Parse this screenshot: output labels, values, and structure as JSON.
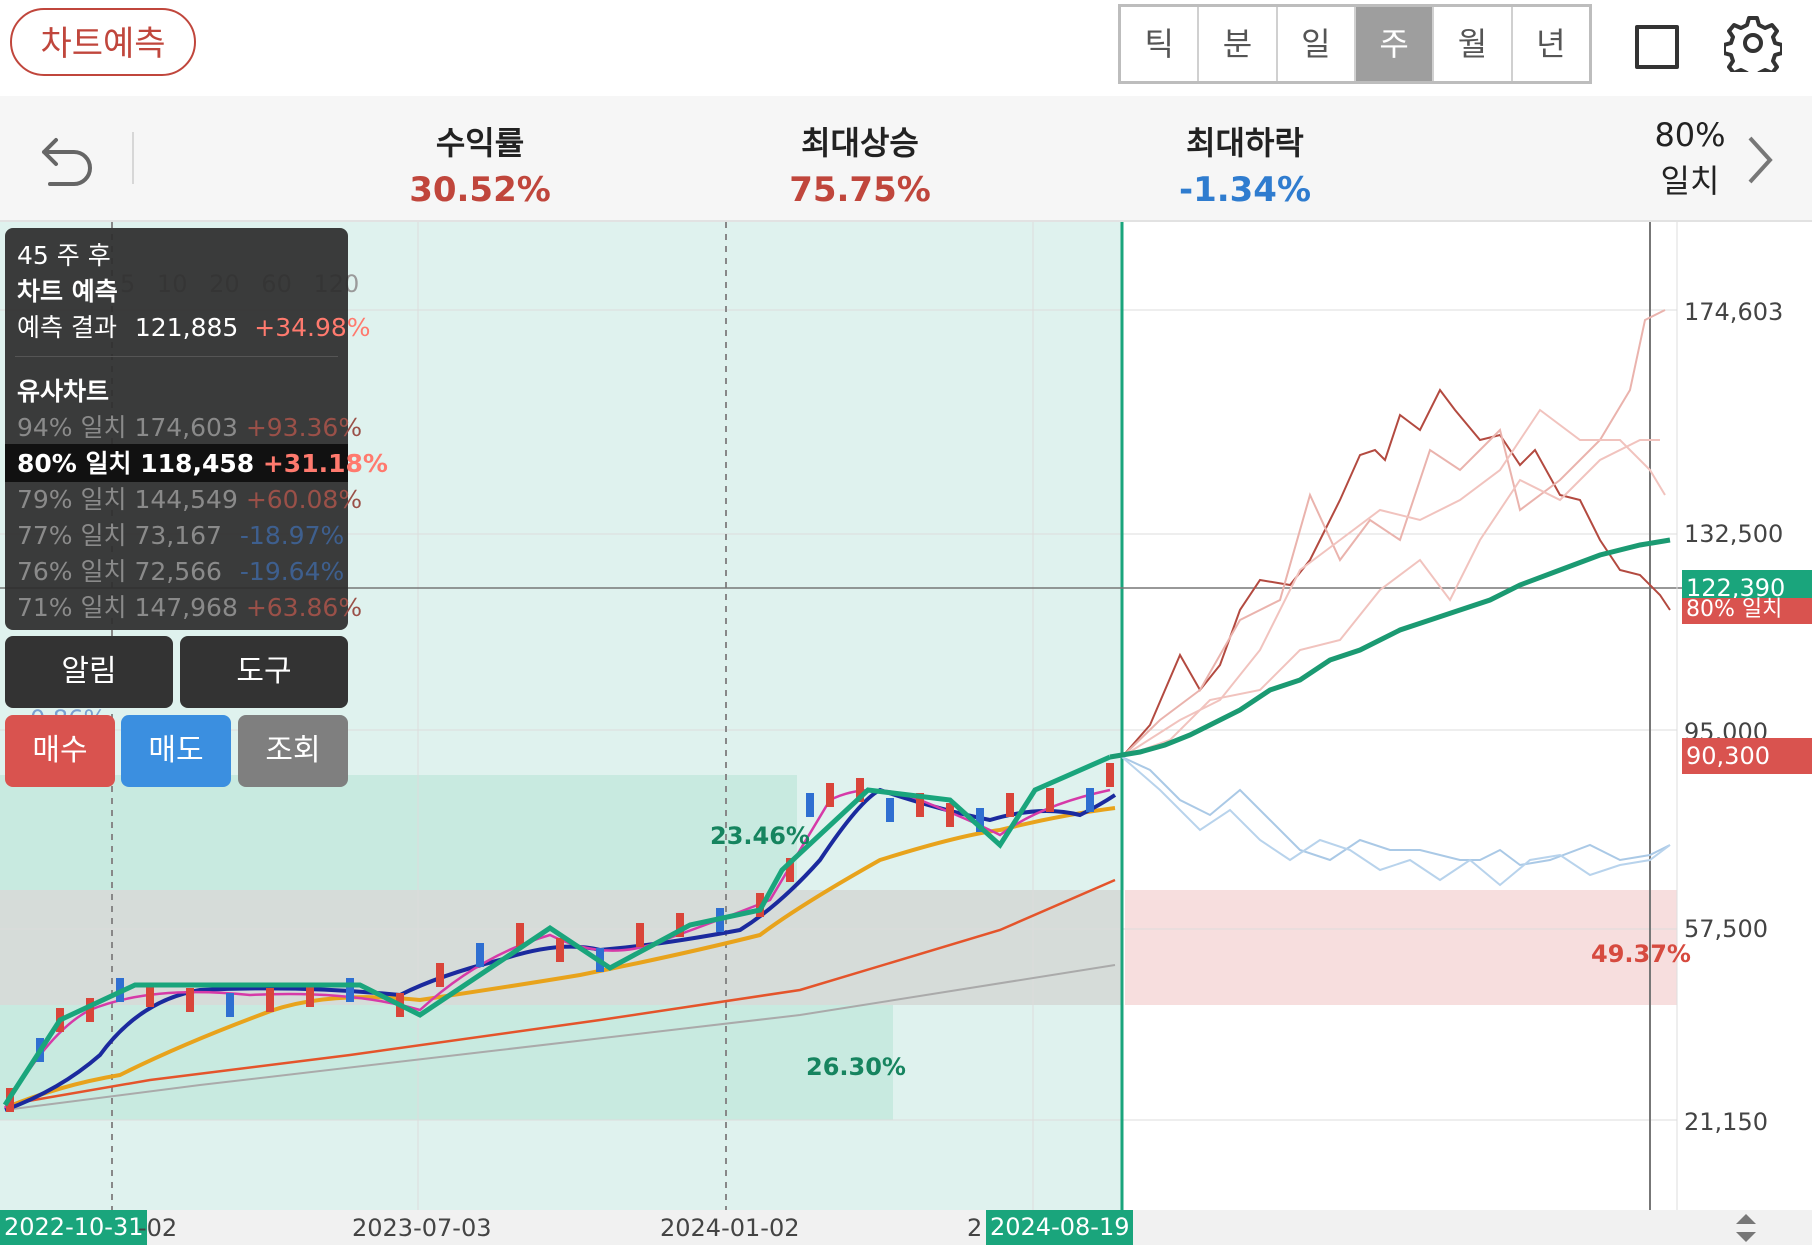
{
  "header": {
    "predict_button": "차트예측",
    "period_tabs": [
      "틱",
      "분",
      "일",
      "주",
      "월",
      "년"
    ],
    "active_tab": "주",
    "icons": [
      "square-icon",
      "gear-icon"
    ]
  },
  "summary": {
    "return_label": "수익률",
    "return_value": "30.52%",
    "max_rise_label": "최대상승",
    "max_rise_value": "75.75%",
    "max_drop_label": "최대하락",
    "max_drop_value": "-1.34%",
    "match_pct": "80%",
    "match_label": "일치",
    "icons": [
      "undo-icon",
      "chevron-right-icon"
    ]
  },
  "panel": {
    "weeks_after": "45 주 후",
    "prediction_title": "차트 예측",
    "prediction_label": "예측 결과",
    "prediction_price": "121,885",
    "prediction_change": "+34.98%",
    "similar_title": "유사차트",
    "similar": [
      {
        "match": "94% 일치",
        "price": "174,603",
        "change": "+93.36%"
      },
      {
        "match": "80% 일치",
        "price": "118,458",
        "change": "+31.18%"
      },
      {
        "match": "79% 일치",
        "price": "144,549",
        "change": "+60.08%"
      },
      {
        "match": "77% 일치",
        "price": "73,167",
        "change": "-18.97%"
      },
      {
        "match": "76% 일치",
        "price": "72,566",
        "change": "-19.64%"
      },
      {
        "match": "71% 일치",
        "price": "147,968",
        "change": "+63.86%"
      }
    ],
    "selected_index": 1
  },
  "buttons": {
    "alarm": "알림",
    "tools": "도구",
    "buy": "매수",
    "sell": "매도",
    "inquiry": "조회"
  },
  "colors": {
    "brand_red": "#c0463c",
    "accent_green": "#1aa57c",
    "buy_red": "#d9534f",
    "sell_blue": "#3b8fe0"
  },
  "chart_data": {
    "type": "line",
    "x_ticks": [
      "2022-10-31",
      "2023-07-03",
      "2024-01-02",
      "2024-08-19"
    ],
    "x_partial_labels": [
      "-02",
      "2"
    ],
    "y_ticks": [
      "174,603",
      "132,500",
      "95,000",
      "57,500",
      "21,150"
    ],
    "current_price_tag": "90,300",
    "prediction_price_tag": "122,390",
    "prediction_tag_label": "80% 일치",
    "zone_labels": [
      "23.46%",
      "26.30%",
      "49.37%"
    ],
    "background_labels": [
      "5",
      "10",
      "20",
      "60",
      "120"
    ],
    "faded_percentages": [
      "0.86%"
    ],
    "series": [
      {
        "x": [
          "2022-10-31",
          "2023-01-02",
          "2023-04-03",
          "2023-07-03",
          "2023-10-02",
          "2024-01-02",
          "2024-04-01",
          "2024-06-03",
          "2024-08-19"
        ],
        "values": [
          21150,
          42000,
          43000,
          34000,
          52000,
          52000,
          78000,
          71000,
          90300
        ]
      }
    ]
  }
}
